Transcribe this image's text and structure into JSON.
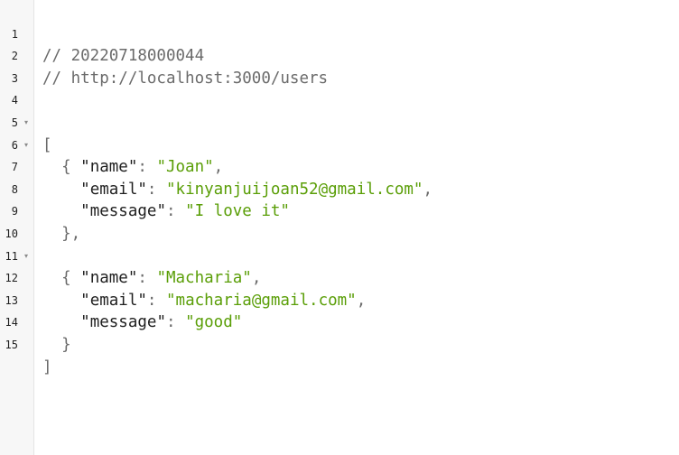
{
  "header": {
    "comment_id": "// 20220718000044",
    "comment_url": "// http://localhost:3000/users"
  },
  "gutter": {
    "numbers": [
      "1",
      "2",
      "3",
      "4",
      "5",
      "6",
      "7",
      "8",
      "9",
      "10",
      "11",
      "12",
      "13",
      "14",
      "15"
    ],
    "fold_glyph": "▾"
  },
  "json_punct": {
    "open_array": "[",
    "close_array": "]",
    "open_obj": "{",
    "close_obj": "}",
    "close_obj_comma": "},",
    "colon": ": ",
    "comma": ","
  },
  "records": [
    {
      "name_key": "\"name\"",
      "name_val": "\"Joan\"",
      "email_key": "\"email\"",
      "email_val": "\"kinyanjuijoan52@gmail.com\"",
      "message_key": "\"message\"",
      "message_val": "\"I love it\""
    },
    {
      "name_key": "\"name\"",
      "name_val": "\"Macharia\"",
      "email_key": "\"email\"",
      "email_val": "\"macharia@gmail.com\"",
      "message_key": "\"message\"",
      "message_val": "\"good\""
    }
  ],
  "colors": {
    "string": "#5a9e07",
    "comment": "#6b6b6b",
    "gutter_bg": "#f7f7f7"
  }
}
